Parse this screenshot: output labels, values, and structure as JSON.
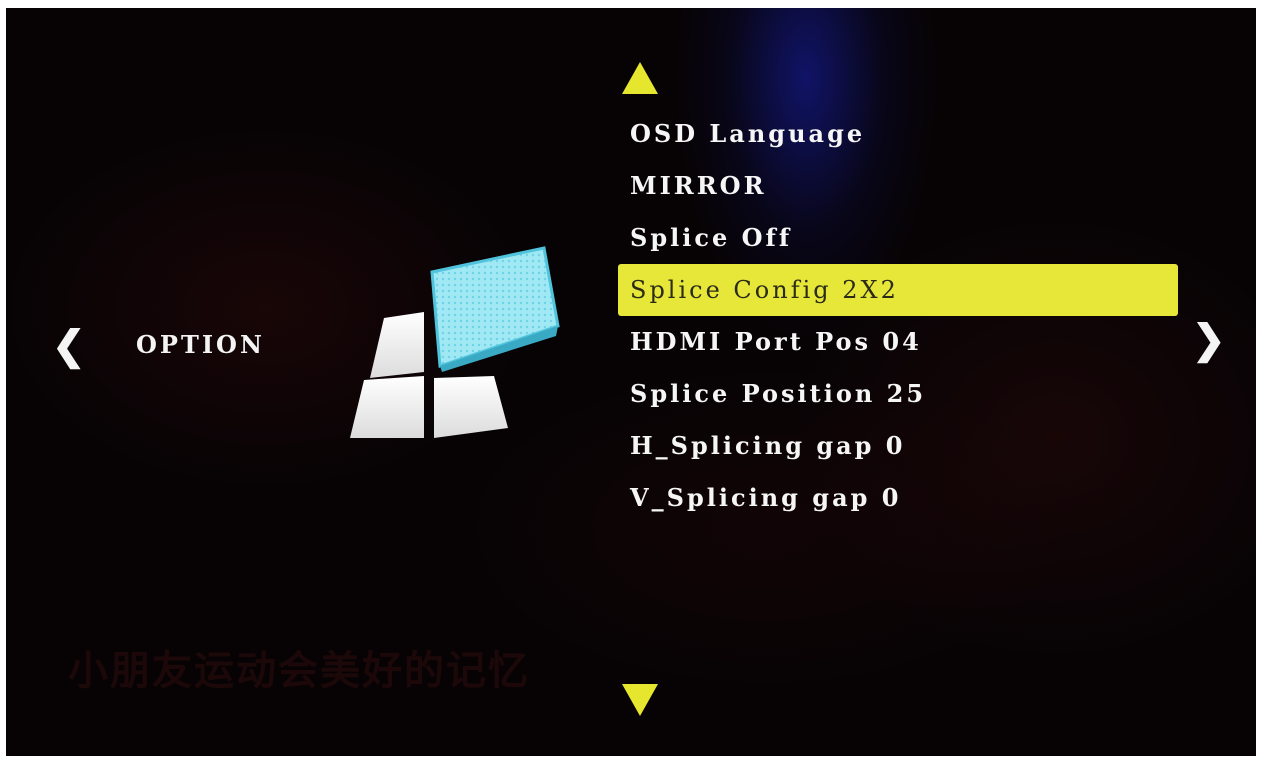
{
  "background_ghost_text": "小朋友运动会美好的记忆",
  "nav": {
    "prev_icon": "chevron-left-icon",
    "prev_glyph": "❮",
    "next_icon": "chevron-right-icon",
    "next_glyph": "❯"
  },
  "category": {
    "label": "OPTION",
    "icon": "splice-tiles-icon"
  },
  "menu": {
    "scroll_up_icon": "triangle-up-icon",
    "scroll_down_icon": "triangle-down-icon",
    "selected_index": 3,
    "items": [
      {
        "label": "OSD Language"
      },
      {
        "label": "MIRROR"
      },
      {
        "label": "Splice Off"
      },
      {
        "label": "Splice Config 2X2"
      },
      {
        "label": "HDMI Port Pos 04"
      },
      {
        "label": "Splice Position 25"
      },
      {
        "label": "H_Splicing gap 0"
      },
      {
        "label": "V_Splicing gap 0"
      }
    ]
  },
  "colors": {
    "highlight": "#e7e73a",
    "arrow": "#e6e62e",
    "text": "#f6f6f6",
    "icon_active": "#7fe0f0",
    "background": "#070305"
  }
}
